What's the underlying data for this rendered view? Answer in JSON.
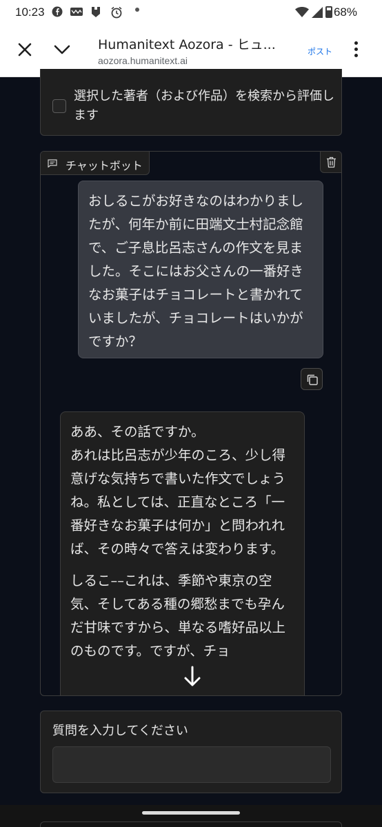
{
  "status_bar": {
    "time": "10:23",
    "battery": "68%"
  },
  "browser": {
    "title": "Humanitext Aozora - ヒュ...",
    "url": "aozora.humanitext.ai",
    "post_label": "ポスト"
  },
  "filters": {
    "checkbox_label": "選択した著者（および作品）を検索から評価します",
    "checked": false
  },
  "chatbot": {
    "tab_label": "チャットボット",
    "user_message": "おしるこがお好きなのはわかりましたが、何年か前に田端文士村記念館で、ご子息比呂志さんの作文を見ました。そこにはお父さんの一番好きなお菓子はチョコレートと書かれていましたが、チョコレートはいかがですか？",
    "bot_paragraphs": [
      "ああ、その話ですか。",
      "あれは比呂志が少年のころ、少し得意げな気持ちで書いた作文でしょうね。私としては、正直なところ「一番好きなお菓子は何か」と問われれば、その時々で答えは変わります。",
      "しるこ––これは、季節や東京の空気、そしてある種の郷愁までも孕んだ甘味ですから、単なる嗜好品以上のものです。ですが、チョ"
    ]
  },
  "question": {
    "label": "質問を入力してください",
    "value": ""
  }
}
